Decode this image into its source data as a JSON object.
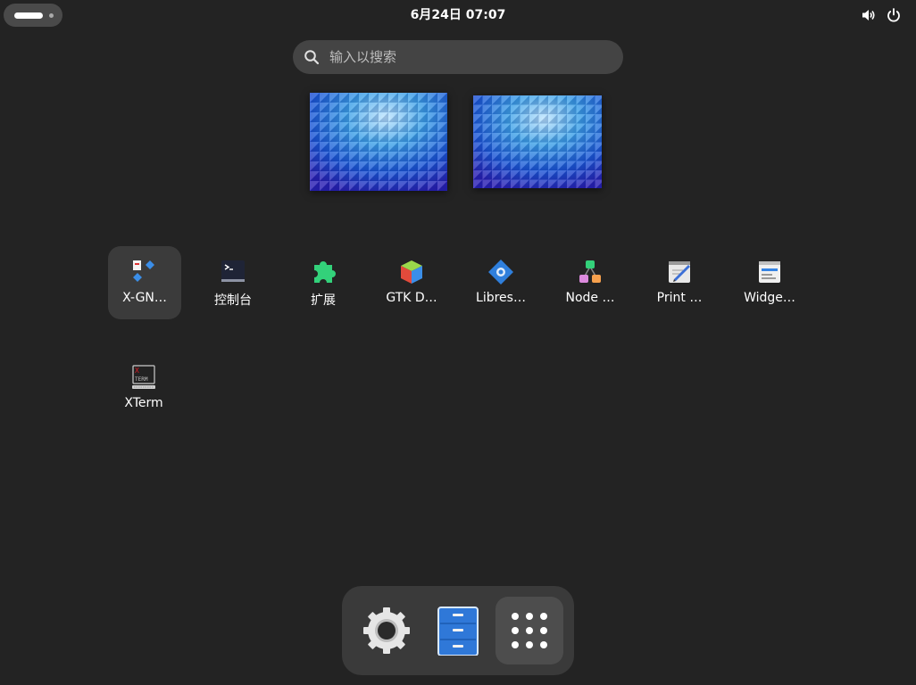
{
  "topbar": {
    "clock": "6月24日  07:07",
    "icons": [
      "volume-icon",
      "power-icon"
    ]
  },
  "search": {
    "placeholder": "输入以搜索"
  },
  "workspaces": [
    {
      "name": "workspace-1"
    },
    {
      "name": "workspace-2"
    }
  ],
  "apps": [
    {
      "label": "X-GN…",
      "icon": "x-gnome-icon",
      "selected": true
    },
    {
      "label": "控制台",
      "icon": "console-icon",
      "selected": false
    },
    {
      "label": "扩展",
      "icon": "extensions-icon",
      "selected": false
    },
    {
      "label": "GTK D…",
      "icon": "gtk-demo-icon",
      "selected": false
    },
    {
      "label": "Libres…",
      "icon": "libreoffice-icon",
      "selected": false
    },
    {
      "label": "Node …",
      "icon": "node-icon",
      "selected": false
    },
    {
      "label": "Print …",
      "icon": "print-icon",
      "selected": false
    },
    {
      "label": "Widge…",
      "icon": "widget-icon",
      "selected": false
    },
    {
      "label": "XTerm",
      "icon": "xterm-icon",
      "selected": false
    }
  ],
  "dock": [
    {
      "name": "settings",
      "icon": "gear-icon"
    },
    {
      "name": "files",
      "icon": "file-cabinet-icon"
    },
    {
      "name": "show-apps",
      "icon": "app-grid-icon",
      "active": true
    }
  ],
  "colors": {
    "background": "#232323",
    "panel": "#3a3a3a",
    "accent": "#3584e4"
  }
}
